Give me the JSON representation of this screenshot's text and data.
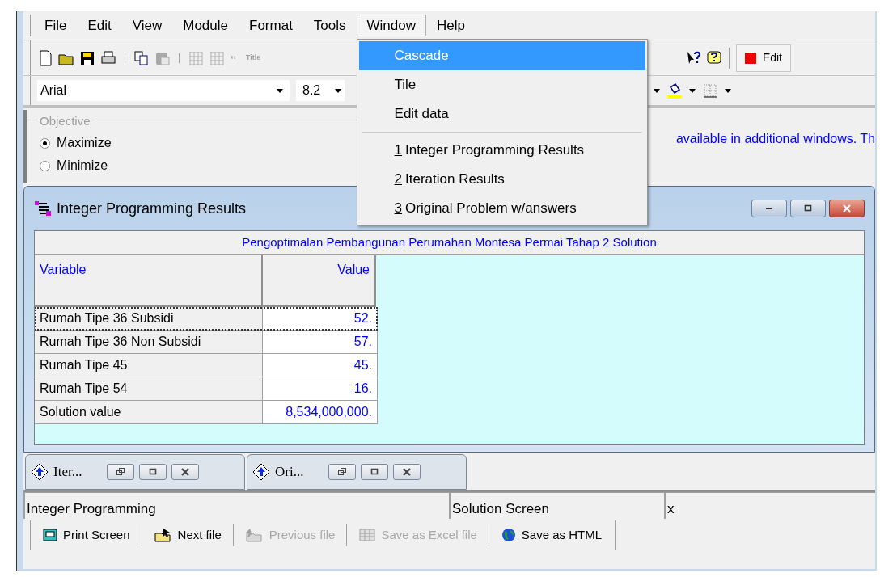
{
  "menu": [
    {
      "label": "File",
      "selected": false
    },
    {
      "label": "Edit",
      "selected": false
    },
    {
      "label": "View",
      "selected": false
    },
    {
      "label": "Module",
      "selected": false
    },
    {
      "label": "Format",
      "selected": false
    },
    {
      "label": "Tools",
      "selected": false
    },
    {
      "label": "Window",
      "selected": true
    },
    {
      "label": "Help",
      "selected": false
    }
  ],
  "window_menu": [
    {
      "kind": "item",
      "label": "Cascade",
      "selected": true
    },
    {
      "kind": "item",
      "label": "Tile",
      "selected": false
    },
    {
      "kind": "item",
      "label": "Edit data",
      "selected": false
    },
    {
      "kind": "separator"
    },
    {
      "kind": "item",
      "accel": "1",
      "label": "Integer Programming Results",
      "selected": false
    },
    {
      "kind": "item",
      "accel": "2",
      "label": "Iteration Results",
      "selected": false
    },
    {
      "kind": "item",
      "accel": "3",
      "label": "Original Problem w/answers",
      "selected": false
    }
  ],
  "toolbar": {
    "title_label": "Title",
    "edit_button": "Edit"
  },
  "format_bar": {
    "font": "Arial",
    "size": "8.2"
  },
  "objective": {
    "legend": "Objective",
    "options": [
      {
        "label": "Maximize",
        "selected": true
      },
      {
        "label": "Minimize",
        "selected": false
      }
    ],
    "note": "available in additional windows. Th"
  },
  "results_window": {
    "title": "Integer Programming Results",
    "table_title": "Pengoptimalan Pembangunan Perumahan Montesa Permai Tahap 2 Solution",
    "columns": [
      "Variable",
      "Value"
    ],
    "rows": [
      {
        "variable": "Rumah Tipe 36 Subsidi",
        "value": "52.",
        "focused": true
      },
      {
        "variable": "Rumah Tipe 36 Non Subsidi",
        "value": "57.",
        "focused": false
      },
      {
        "variable": "Rumah Tipe 45",
        "value": "45.",
        "focused": false
      },
      {
        "variable": "Rumah Tipe 54",
        "value": "16.",
        "focused": false
      },
      {
        "variable": "Solution value",
        "value": "8,534,000,000.",
        "focused": false
      }
    ]
  },
  "minimized_windows": [
    {
      "title": "Iter..."
    },
    {
      "title": "Ori..."
    }
  ],
  "status_bar": [
    "Integer Programming",
    "Solution Screen",
    "x"
  ],
  "bottom_toolbar": [
    {
      "kind": "print",
      "label": "Print Screen",
      "disabled": false
    },
    {
      "kind": "next",
      "label": "Next file",
      "disabled": false
    },
    {
      "kind": "previous",
      "label": "Previous file",
      "disabled": true
    },
    {
      "kind": "excel",
      "label": "Save as Excel file",
      "disabled": true
    },
    {
      "kind": "globe",
      "label": "Save as HTML",
      "disabled": false
    }
  ]
}
